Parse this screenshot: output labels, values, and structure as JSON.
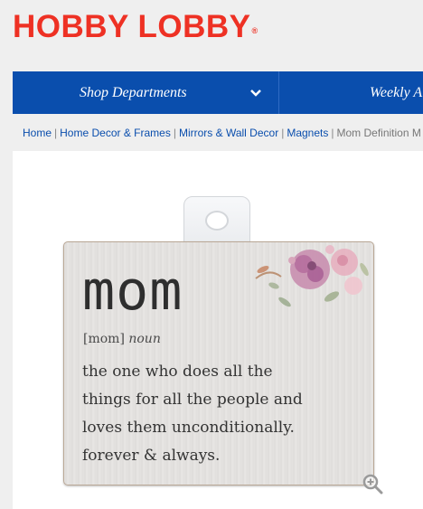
{
  "header": {
    "logo_text": "HOBBY LOBBY",
    "logo_mark": "®"
  },
  "nav": {
    "shop_departments": "Shop Departments",
    "chevron_icon": "chevron-down-icon",
    "weekly": "Weekly A"
  },
  "breadcrumb": {
    "items": [
      "Home",
      "Home Decor & Frames",
      "Mirrors & Wall Decor",
      "Magnets"
    ],
    "current": "Mom Definition M",
    "separator": "|"
  },
  "product_image": {
    "word": "mom",
    "pronunciation": "[mom]",
    "part_of_speech": "noun",
    "definition_lines": [
      "the one who does all the",
      "things for all the people and",
      "loves them unconditionally.",
      "forever & always."
    ],
    "zoom_icon": "zoom-in-icon"
  },
  "colors": {
    "brand_red": "#ee3124",
    "nav_blue": "#0a4ead",
    "link_blue": "#0a4ead",
    "page_bg": "#efefef"
  }
}
